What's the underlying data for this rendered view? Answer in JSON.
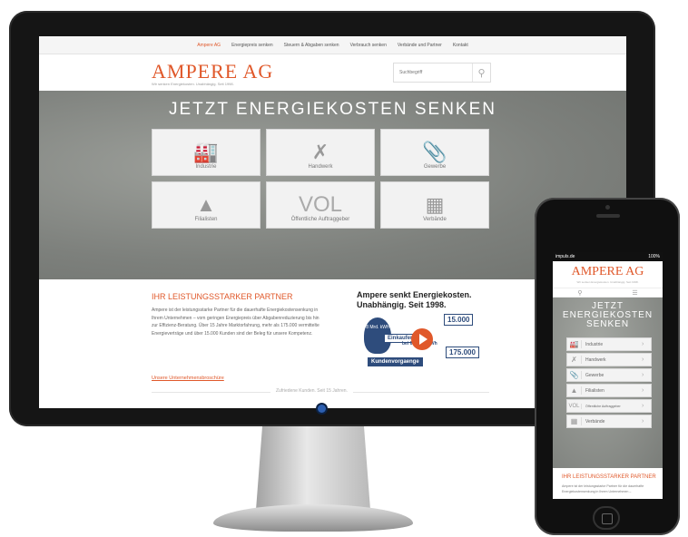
{
  "desktop": {
    "nav": [
      "Ampere AG",
      "Energiepreis senken",
      "Steuern & Abgaben senken",
      "Verbrauch senken",
      "Verbände und Partner",
      "Kontakt"
    ],
    "logo": "AMPERE AG",
    "tagline": "Wir senken Energiekosten. Unabhängig. Seit 1998.",
    "search_placeholder": "Suchbegriff",
    "hero_title": "JETZT ENERGIEKOSTEN SENKEN",
    "tiles": [
      {
        "label": "Industrie",
        "icon": "factory-icon"
      },
      {
        "label": "Handwerk",
        "icon": "tools-icon"
      },
      {
        "label": "Gewerbe",
        "icon": "paperclip-icon"
      },
      {
        "label": "Filialisten",
        "icon": "germany-map-icon"
      },
      {
        "label": "Öffentliche Auftraggeber",
        "icon": "vol-icon",
        "icon_text": "VOL"
      },
      {
        "label": "Verbände",
        "icon": "buildings-icon"
      }
    ],
    "section_title": "IHR LEISTUNGSSTARKER PARTNER",
    "body_text": "Ampere ist der leistungsstarke Partner für die dauerhafte Energiekostensenkung in Ihrem Unternehmen – vom geringen Energiepreis über Abgabenreduzierung bis hin zur Effizienz-Beratung. Über 15 Jahre Marktorfahrung, mehr als 175.000 vermittelte Energieverträge und über 15.000 Kunden sind der Beleg für unsere Kompetenz.",
    "brochure_link": "Unsere Unternehmensbroschüre",
    "video_title": "Ampere senkt Energiekosten. Unabhängig. Seit 1998.",
    "video": {
      "bulb": "8 Mrd. kWh",
      "box1": "Einkaufen",
      "box2": "15.000",
      "box3": "175.000",
      "box4": "Kundenvorgaenge",
      "box5": "bei 600.000 kWh"
    },
    "divider_text": "Zufriedene Kunden. Seit 15 Jahren."
  },
  "phone": {
    "status_left": "impuls.de",
    "status_right": "100%",
    "logo": "AMPERE AG",
    "tagline": "Wir senken Energiekosten. Unabhängig. Seit 1998.",
    "hero_title": "JETZT ENERGIEKOSTEN SENKEN",
    "items": [
      {
        "label": "Industrie",
        "icon": "factory-icon"
      },
      {
        "label": "Handwerk",
        "icon": "tools-icon"
      },
      {
        "label": "Gewerbe",
        "icon": "paperclip-icon"
      },
      {
        "label": "Filialisten",
        "icon": "germany-map-icon"
      },
      {
        "label": "Öffentliche Auftraggeber",
        "icon": "vol-icon",
        "icon_text": "VOL"
      },
      {
        "label": "Verbände",
        "icon": "buildings-icon"
      }
    ],
    "section_title": "IHR LEISTUNGSSTARKER PARTNER",
    "body_text": "Ampere ist der leistungsstarke Partner für die dauerhafte Energiekostensenkung in Ihrem Unternehmen –"
  },
  "colors": {
    "brand": "#e0582a",
    "text": "#666666"
  }
}
